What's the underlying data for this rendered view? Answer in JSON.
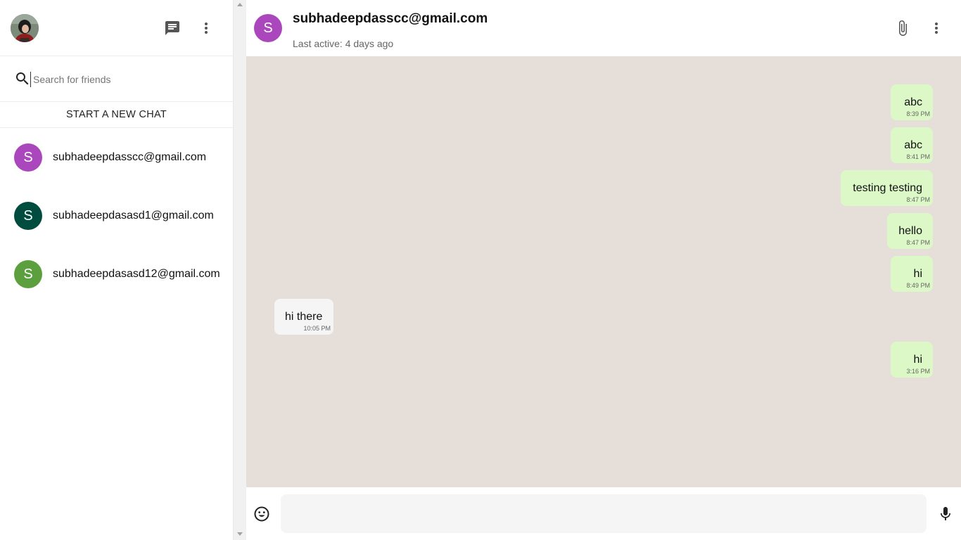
{
  "sidebar": {
    "search": {
      "placeholder": "Search for friends",
      "value": ""
    },
    "new_chat_label": "START A NEW CHAT",
    "contacts": [
      {
        "initial": "S",
        "name": "subhadeepdasscc@gmail.com",
        "color": "#ab47bc"
      },
      {
        "initial": "S",
        "name": "subhadeepdasasd1@gmail.com",
        "color": "#004d40"
      },
      {
        "initial": "S",
        "name": "subhadeepdasasd12@gmail.com",
        "color": "#5c9f3e"
      }
    ]
  },
  "chat": {
    "header": {
      "initial": "S",
      "title": "subhadeepdasscc@gmail.com",
      "subtitle": "Last active: 4 days ago",
      "avatar_color": "#ab47bc"
    },
    "messages": [
      {
        "text": "abc",
        "time": "8:39 PM",
        "direction": "sent"
      },
      {
        "text": "abc",
        "time": "8:41 PM",
        "direction": "sent"
      },
      {
        "text": "testing testing",
        "time": "8:47 PM",
        "direction": "sent"
      },
      {
        "text": "hello",
        "time": "8:47 PM",
        "direction": "sent"
      },
      {
        "text": "hi",
        "time": "8:49 PM",
        "direction": "sent"
      },
      {
        "text": "hi there",
        "time": "10:05 PM",
        "direction": "received"
      },
      {
        "text": "hi",
        "time": "3:16 PM",
        "direction": "sent"
      }
    ],
    "composer": {
      "value": "",
      "placeholder": ""
    }
  },
  "colors": {
    "chat_background": "#e5ded9",
    "sent_bubble": "#dcf8c6",
    "received_bubble": "#f5f5f5"
  },
  "icons": {
    "new_chat": "message-icon",
    "sidebar_menu": "more-vert-icon",
    "search": "search-icon",
    "attach": "attach-file-icon",
    "chat_menu": "more-vert-icon",
    "emoji": "emoji-icon",
    "mic": "mic-icon"
  }
}
